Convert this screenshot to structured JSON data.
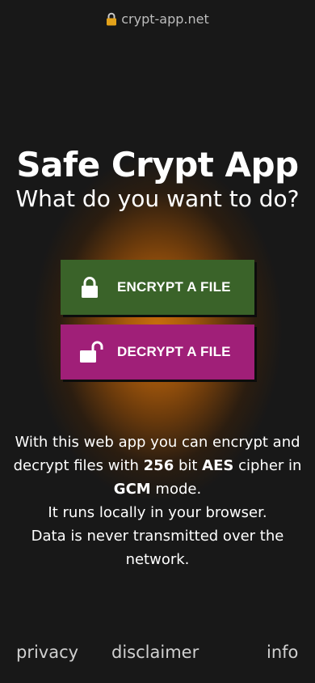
{
  "browser": {
    "url": "crypt-app.net",
    "lock_icon": "lock-icon",
    "lock_color": "#e3a21a"
  },
  "hero": {
    "title": "Safe Crypt App",
    "subtitle": "What do you want to do?"
  },
  "actions": {
    "encrypt": {
      "label": "ENCRYPT A FILE",
      "icon": "lock-closed-icon",
      "color": "#3a6329"
    },
    "decrypt": {
      "label": "DECRYPT A FILE",
      "icon": "lock-open-icon",
      "color": "#a01f78"
    }
  },
  "description": {
    "line1_pre": "With this web app you can encrypt and decrypt files with ",
    "key_bits": "256",
    "bit_word": " bit ",
    "cipher": "AES",
    "cipher_in": " cipher in ",
    "mode": "GCM",
    "mode_word": " mode.",
    "local_note": "It runs locally in your browser.",
    "privacy_note": "Data is never transmitted over the network."
  },
  "footer": {
    "privacy": "privacy",
    "disclaimer": "disclaimer",
    "info": "info"
  },
  "theme": {
    "background": "#181818",
    "glow": "#c86e0c"
  }
}
